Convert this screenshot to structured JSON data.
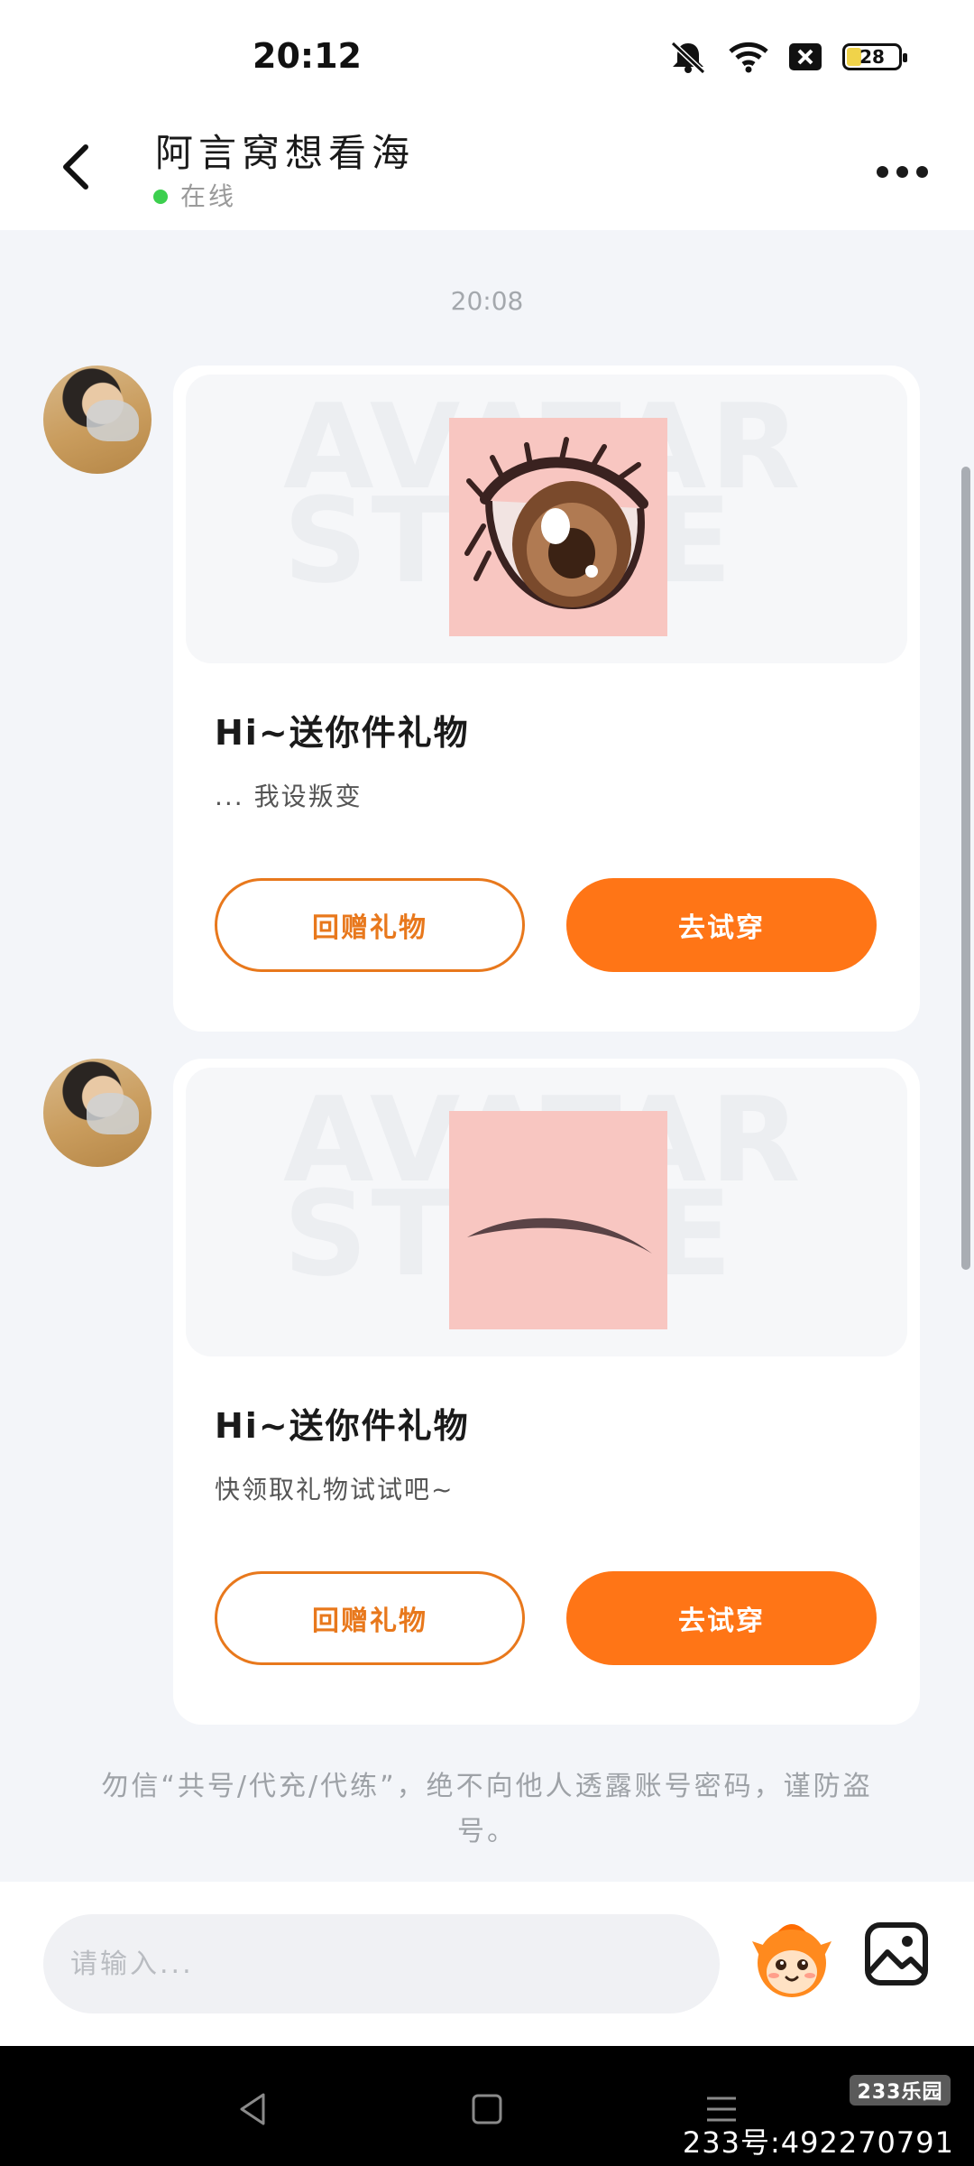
{
  "status_bar": {
    "time": "20:12",
    "battery_level": "28",
    "icons": [
      "mute-icon",
      "wifi-icon",
      "sim-blocked-icon",
      "battery-icon"
    ]
  },
  "header": {
    "title": "阿言窝想看海",
    "status": "在线",
    "back_icon": "chevron-left-icon",
    "more_icon": "more-horizontal-icon"
  },
  "chat": {
    "timestamp": "20:08",
    "messages": [
      {
        "type": "gift",
        "watermark": "AVATAR STORE",
        "item_icon": "eye-icon",
        "title": "Hi~送你件礼物",
        "subtitle": "... 我设叛变",
        "return_label": "回赠礼物",
        "try_label": "去试穿"
      },
      {
        "type": "gift",
        "watermark": "AVATAR STORE",
        "item_icon": "eyebrow-icon",
        "title": "Hi~送你件礼物",
        "subtitle": "快领取礼物试试吧~",
        "return_label": "回赠礼物",
        "try_label": "去试穿"
      }
    ],
    "notice": "勿信“共号/代充/代练”，绝不向他人透露账号密码，谨防盗号。"
  },
  "input_bar": {
    "placeholder": "请输入...",
    "emoji_icon": "mascot-emoji-icon",
    "image_icon": "image-icon"
  },
  "nav_bar": {
    "icons": [
      "nav-back-icon",
      "nav-home-icon",
      "nav-recents-icon"
    ],
    "watermark_badge": "233乐园",
    "watermark_id": "233号:492270791"
  },
  "colors": {
    "accent": "#ff7516",
    "online": "#3ccf4e",
    "background": "#f3f5f9"
  }
}
